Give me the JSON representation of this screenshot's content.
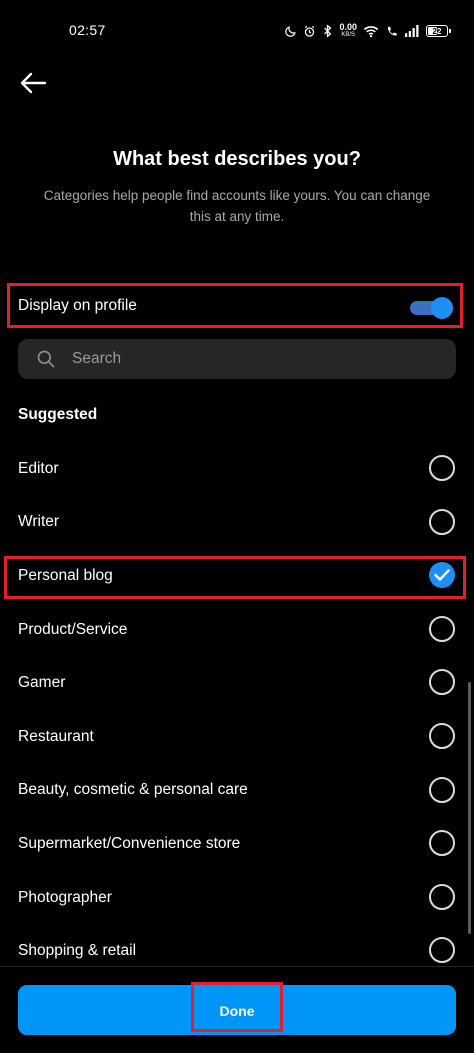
{
  "status_bar": {
    "time": "02:57",
    "net_speed_value": "0.00",
    "net_speed_unit": "KB/S",
    "battery": "22"
  },
  "header": {
    "title": "What best describes you?",
    "subtitle": "Categories help people find accounts like yours. You can change this at any time."
  },
  "display_on_profile": {
    "label": "Display on profile",
    "enabled": true
  },
  "search": {
    "placeholder": "Search",
    "value": ""
  },
  "suggested": {
    "label": "Suggested",
    "items": [
      {
        "label": "Editor",
        "selected": false
      },
      {
        "label": "Writer",
        "selected": false
      },
      {
        "label": "Personal blog",
        "selected": true
      },
      {
        "label": "Product/Service",
        "selected": false
      },
      {
        "label": "Gamer",
        "selected": false
      },
      {
        "label": "Restaurant",
        "selected": false
      },
      {
        "label": "Beauty, cosmetic & personal care",
        "selected": false
      },
      {
        "label": "Supermarket/Convenience store",
        "selected": false
      },
      {
        "label": "Photographer",
        "selected": false
      },
      {
        "label": "Shopping & retail",
        "selected": false
      }
    ]
  },
  "footer": {
    "done_label": "Done"
  },
  "colors": {
    "accent": "#0095f6",
    "highlight": "#e0202c",
    "background": "#000000"
  }
}
